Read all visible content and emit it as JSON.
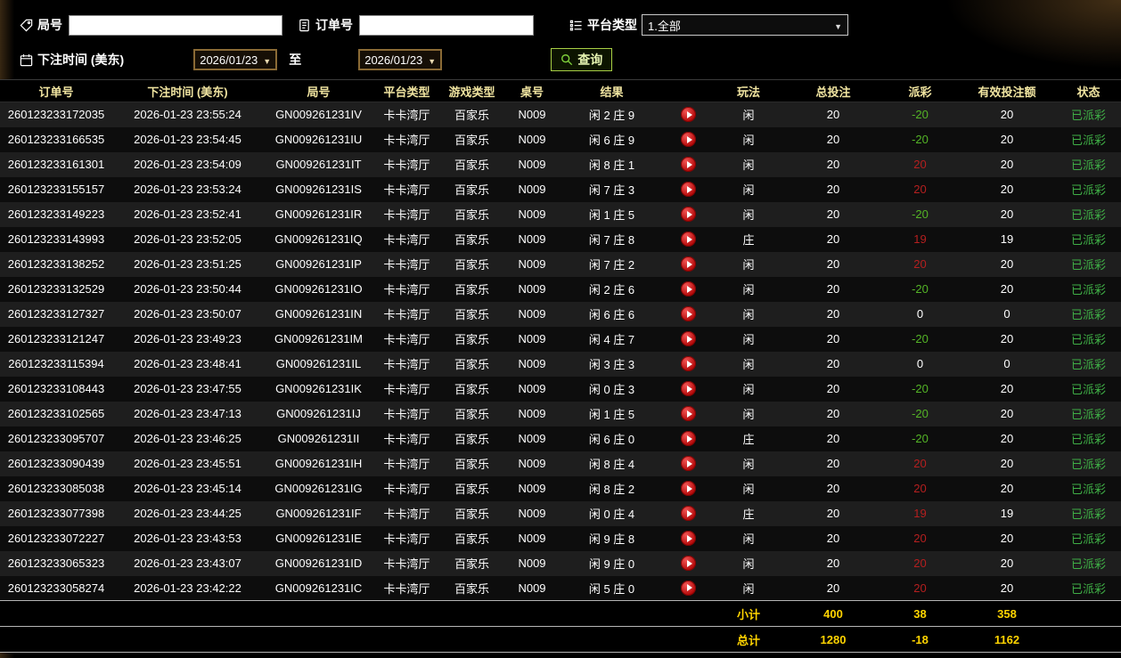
{
  "filters": {
    "round_no": {
      "label": "局号",
      "value": "",
      "icon": "tag-icon"
    },
    "order_no": {
      "label": "订单号",
      "value": "",
      "icon": "document-icon"
    },
    "platform_type": {
      "label": "平台类型",
      "value": "1.全部",
      "icon": "list-icon"
    },
    "bet_time": {
      "label": "下注时间 (美东)",
      "icon": "calendar-icon",
      "from": "2026/01/23",
      "to_label": "至",
      "to": "2026/01/23"
    },
    "query_button": "查询"
  },
  "table": {
    "headers": [
      "订单号",
      "下注时间 (美东)",
      "局号",
      "平台类型",
      "游戏类型",
      "桌号",
      "结果",
      "",
      "玩法",
      "总投注",
      "派彩",
      "有效投注额",
      "状态"
    ],
    "rows": [
      {
        "order_id": "260123233172035",
        "bet_time": "2026-01-23 23:55:24",
        "round_id": "GN009261231IV",
        "platform": "卡卡湾厅",
        "game_type": "百家乐",
        "table_no": "N009",
        "result": "闲 2 庄 9",
        "play": "闲",
        "total_bet": "20",
        "payout": "-20",
        "valid_bet": "20",
        "status": "已派彩"
      },
      {
        "order_id": "260123233166535",
        "bet_time": "2026-01-23 23:54:45",
        "round_id": "GN009261231IU",
        "platform": "卡卡湾厅",
        "game_type": "百家乐",
        "table_no": "N009",
        "result": "闲 6 庄 9",
        "play": "闲",
        "total_bet": "20",
        "payout": "-20",
        "valid_bet": "20",
        "status": "已派彩"
      },
      {
        "order_id": "260123233161301",
        "bet_time": "2026-01-23 23:54:09",
        "round_id": "GN009261231IT",
        "platform": "卡卡湾厅",
        "game_type": "百家乐",
        "table_no": "N009",
        "result": "闲 8 庄 1",
        "play": "闲",
        "total_bet": "20",
        "payout": "20",
        "valid_bet": "20",
        "status": "已派彩"
      },
      {
        "order_id": "260123233155157",
        "bet_time": "2026-01-23 23:53:24",
        "round_id": "GN009261231IS",
        "platform": "卡卡湾厅",
        "game_type": "百家乐",
        "table_no": "N009",
        "result": "闲 7 庄 3",
        "play": "闲",
        "total_bet": "20",
        "payout": "20",
        "valid_bet": "20",
        "status": "已派彩"
      },
      {
        "order_id": "260123233149223",
        "bet_time": "2026-01-23 23:52:41",
        "round_id": "GN009261231IR",
        "platform": "卡卡湾厅",
        "game_type": "百家乐",
        "table_no": "N009",
        "result": "闲 1 庄 5",
        "play": "闲",
        "total_bet": "20",
        "payout": "-20",
        "valid_bet": "20",
        "status": "已派彩"
      },
      {
        "order_id": "260123233143993",
        "bet_time": "2026-01-23 23:52:05",
        "round_id": "GN009261231IQ",
        "platform": "卡卡湾厅",
        "game_type": "百家乐",
        "table_no": "N009",
        "result": "闲 7 庄 8",
        "play": "庄",
        "total_bet": "20",
        "payout": "19",
        "valid_bet": "19",
        "status": "已派彩"
      },
      {
        "order_id": "260123233138252",
        "bet_time": "2026-01-23 23:51:25",
        "round_id": "GN009261231IP",
        "platform": "卡卡湾厅",
        "game_type": "百家乐",
        "table_no": "N009",
        "result": "闲 7 庄 2",
        "play": "闲",
        "total_bet": "20",
        "payout": "20",
        "valid_bet": "20",
        "status": "已派彩"
      },
      {
        "order_id": "260123233132529",
        "bet_time": "2026-01-23 23:50:44",
        "round_id": "GN009261231IO",
        "platform": "卡卡湾厅",
        "game_type": "百家乐",
        "table_no": "N009",
        "result": "闲 2 庄 6",
        "play": "闲",
        "total_bet": "20",
        "payout": "-20",
        "valid_bet": "20",
        "status": "已派彩"
      },
      {
        "order_id": "260123233127327",
        "bet_time": "2026-01-23 23:50:07",
        "round_id": "GN009261231IN",
        "platform": "卡卡湾厅",
        "game_type": "百家乐",
        "table_no": "N009",
        "result": "闲 6 庄 6",
        "play": "闲",
        "total_bet": "20",
        "payout": "0",
        "valid_bet": "0",
        "status": "已派彩"
      },
      {
        "order_id": "260123233121247",
        "bet_time": "2026-01-23 23:49:23",
        "round_id": "GN009261231IM",
        "platform": "卡卡湾厅",
        "game_type": "百家乐",
        "table_no": "N009",
        "result": "闲 4 庄 7",
        "play": "闲",
        "total_bet": "20",
        "payout": "-20",
        "valid_bet": "20",
        "status": "已派彩"
      },
      {
        "order_id": "260123233115394",
        "bet_time": "2026-01-23 23:48:41",
        "round_id": "GN009261231IL",
        "platform": "卡卡湾厅",
        "game_type": "百家乐",
        "table_no": "N009",
        "result": "闲 3 庄 3",
        "play": "闲",
        "total_bet": "20",
        "payout": "0",
        "valid_bet": "0",
        "status": "已派彩"
      },
      {
        "order_id": "260123233108443",
        "bet_time": "2026-01-23 23:47:55",
        "round_id": "GN009261231IK",
        "platform": "卡卡湾厅",
        "game_type": "百家乐",
        "table_no": "N009",
        "result": "闲 0 庄 3",
        "play": "闲",
        "total_bet": "20",
        "payout": "-20",
        "valid_bet": "20",
        "status": "已派彩"
      },
      {
        "order_id": "260123233102565",
        "bet_time": "2026-01-23 23:47:13",
        "round_id": "GN009261231IJ",
        "platform": "卡卡湾厅",
        "game_type": "百家乐",
        "table_no": "N009",
        "result": "闲 1 庄 5",
        "play": "闲",
        "total_bet": "20",
        "payout": "-20",
        "valid_bet": "20",
        "status": "已派彩"
      },
      {
        "order_id": "260123233095707",
        "bet_time": "2026-01-23 23:46:25",
        "round_id": "GN009261231II",
        "platform": "卡卡湾厅",
        "game_type": "百家乐",
        "table_no": "N009",
        "result": "闲 6 庄 0",
        "play": "庄",
        "total_bet": "20",
        "payout": "-20",
        "valid_bet": "20",
        "status": "已派彩"
      },
      {
        "order_id": "260123233090439",
        "bet_time": "2026-01-23 23:45:51",
        "round_id": "GN009261231IH",
        "platform": "卡卡湾厅",
        "game_type": "百家乐",
        "table_no": "N009",
        "result": "闲 8 庄 4",
        "play": "闲",
        "total_bet": "20",
        "payout": "20",
        "valid_bet": "20",
        "status": "已派彩"
      },
      {
        "order_id": "260123233085038",
        "bet_time": "2026-01-23 23:45:14",
        "round_id": "GN009261231IG",
        "platform": "卡卡湾厅",
        "game_type": "百家乐",
        "table_no": "N009",
        "result": "闲 8 庄 2",
        "play": "闲",
        "total_bet": "20",
        "payout": "20",
        "valid_bet": "20",
        "status": "已派彩"
      },
      {
        "order_id": "260123233077398",
        "bet_time": "2026-01-23 23:44:25",
        "round_id": "GN009261231IF",
        "platform": "卡卡湾厅",
        "game_type": "百家乐",
        "table_no": "N009",
        "result": "闲 0 庄 4",
        "play": "庄",
        "total_bet": "20",
        "payout": "19",
        "valid_bet": "19",
        "status": "已派彩"
      },
      {
        "order_id": "260123233072227",
        "bet_time": "2026-01-23 23:43:53",
        "round_id": "GN009261231IE",
        "platform": "卡卡湾厅",
        "game_type": "百家乐",
        "table_no": "N009",
        "result": "闲 9 庄 8",
        "play": "闲",
        "total_bet": "20",
        "payout": "20",
        "valid_bet": "20",
        "status": "已派彩"
      },
      {
        "order_id": "260123233065323",
        "bet_time": "2026-01-23 23:43:07",
        "round_id": "GN009261231ID",
        "platform": "卡卡湾厅",
        "game_type": "百家乐",
        "table_no": "N009",
        "result": "闲 9 庄 0",
        "play": "闲",
        "total_bet": "20",
        "payout": "20",
        "valid_bet": "20",
        "status": "已派彩"
      },
      {
        "order_id": "260123233058274",
        "bet_time": "2026-01-23 23:42:22",
        "round_id": "GN009261231IC",
        "platform": "卡卡湾厅",
        "game_type": "百家乐",
        "table_no": "N009",
        "result": "闲 5 庄 0",
        "play": "闲",
        "total_bet": "20",
        "payout": "20",
        "valid_bet": "20",
        "status": "已派彩"
      }
    ],
    "subtotal": {
      "label": "小计",
      "total_bet": "400",
      "payout": "38",
      "valid_bet": "358"
    },
    "grand_total": {
      "label": "总计",
      "total_bet": "1280",
      "payout": "-18",
      "valid_bet": "1162"
    }
  },
  "colors": {
    "header_yellow": "#f0e4a0",
    "footer_yellow": "#ffd400",
    "win_red": "#b51f1f",
    "loss_green": "#54b426",
    "status_green": "#3faf46",
    "query_green": "#a8cf45"
  }
}
